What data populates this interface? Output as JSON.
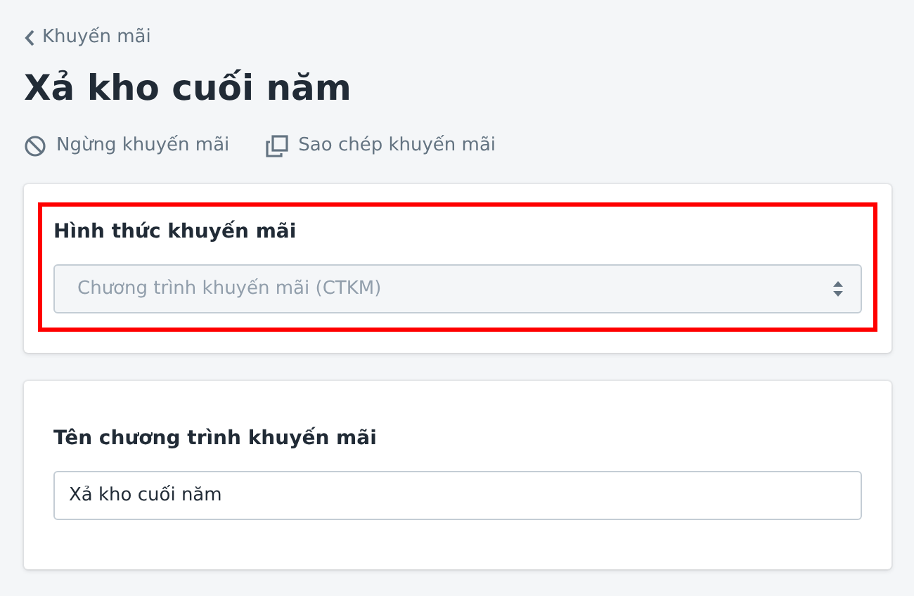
{
  "breadcrumb": {
    "label": "Khuyến mãi"
  },
  "title": "Xả kho cuối năm",
  "actions": [
    {
      "kind": "stop",
      "label": "Ngừng khuyến mãi"
    },
    {
      "kind": "copy",
      "label": "Sao chép khuyến mãi"
    }
  ],
  "cards": [
    {
      "label": "Hình thức khuyến mãi",
      "kind": "select",
      "value": "Chương trình khuyến mãi (CTKM)",
      "disabled": true,
      "highlighted": true
    },
    {
      "label": "Tên chương trình khuyến mãi",
      "kind": "input",
      "value": "Xả kho cuối năm",
      "disabled": false,
      "highlighted": false
    }
  ]
}
